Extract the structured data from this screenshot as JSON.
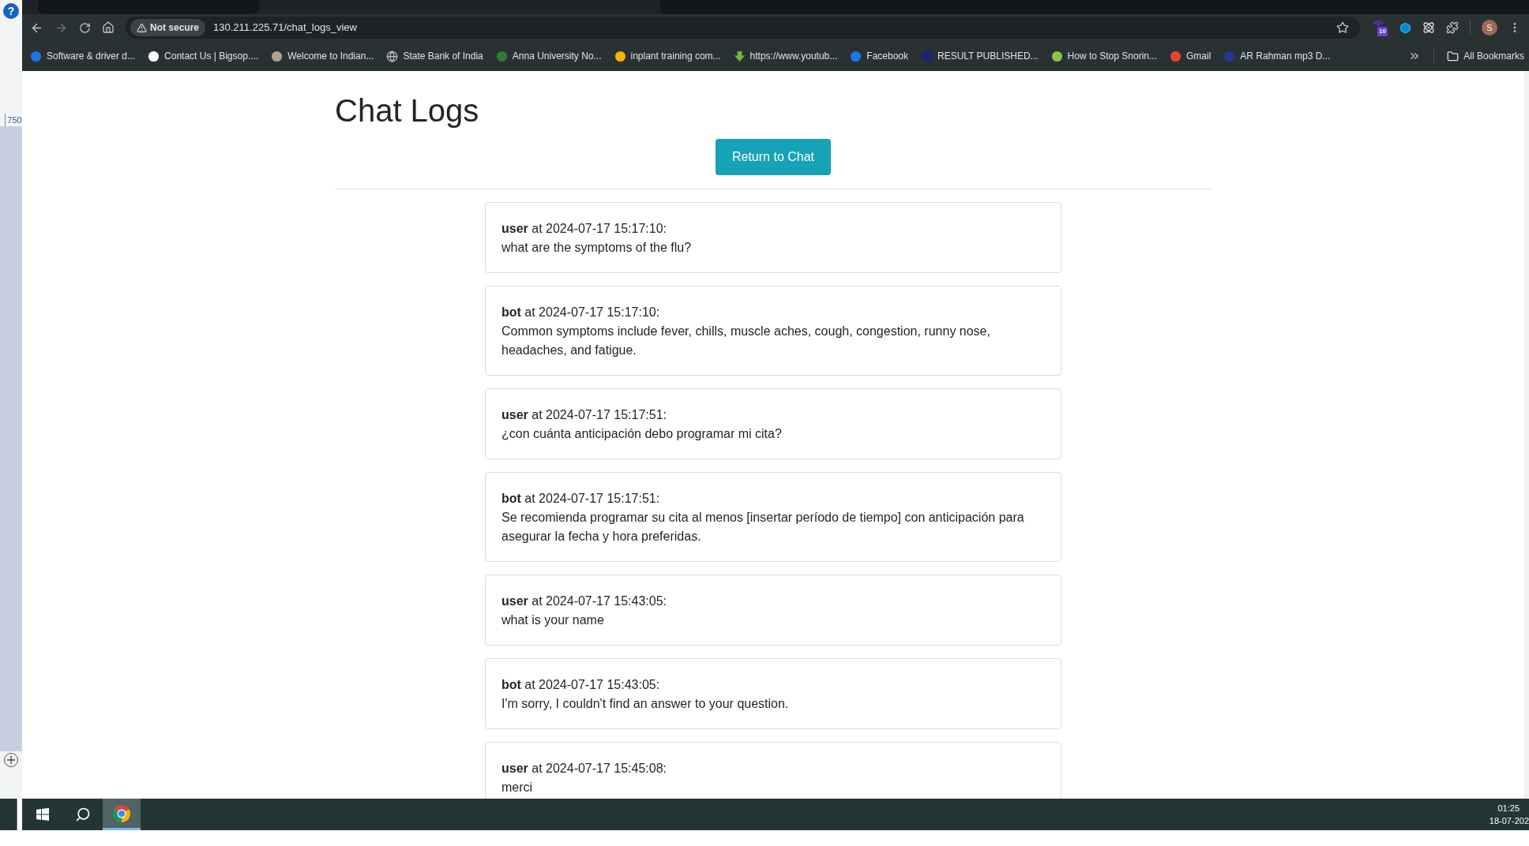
{
  "left_strip": {
    "help": "?",
    "ruler_label": "750"
  },
  "browser": {
    "security": "Not secure",
    "url": "130.211.225.71/chat_logs_view",
    "extension_badge": "10",
    "profile_initial": "S",
    "bookmarks": [
      "Software & driver d...",
      "Contact Us | Bigsop....",
      "Welcome to Indian...",
      "State Bank of India",
      "Anna University No...",
      "inplant training com...",
      "https://www.youtub...",
      "Facebook",
      "RESULT PUBLISHED...",
      "How to Stop Snorin...",
      "Gmail",
      "AR Rahman mp3 D..."
    ],
    "all_bookmarks": "All Bookmarks"
  },
  "page": {
    "title": "Chat Logs",
    "button": "Return to Chat",
    "logs": [
      {
        "header": "**user** at 2024-07-17 15:17:10:",
        "message": "what are the symptoms of the flu?"
      },
      {
        "header": "**bot** at 2024-07-17 15:17:10:",
        "message": "Common symptoms include fever, chills, muscle aches, cough, congestion, runny nose, headaches, and fatigue."
      },
      {
        "header": "**user** at 2024-07-17 15:17:51:",
        "message": "¿con cuánta anticipación debo programar mi cita?"
      },
      {
        "header": "**bot** at 2024-07-17 15:17:51:",
        "message": "Se recomienda programar su cita al menos [insertar período de tiempo] con anticipación para asegurar la fecha y hora preferidas."
      },
      {
        "header": "**user** at 2024-07-17 15:43:05:",
        "message": "what is your name"
      },
      {
        "header": "**bot** at 2024-07-17 15:43:05:",
        "message": "I'm sorry, I couldn't find an answer to your question."
      },
      {
        "header": "**user** at 2024-07-17 15:45:08:",
        "message": "merci"
      }
    ]
  },
  "taskbar": {
    "time": "01:25",
    "date": "18-07-202"
  }
}
